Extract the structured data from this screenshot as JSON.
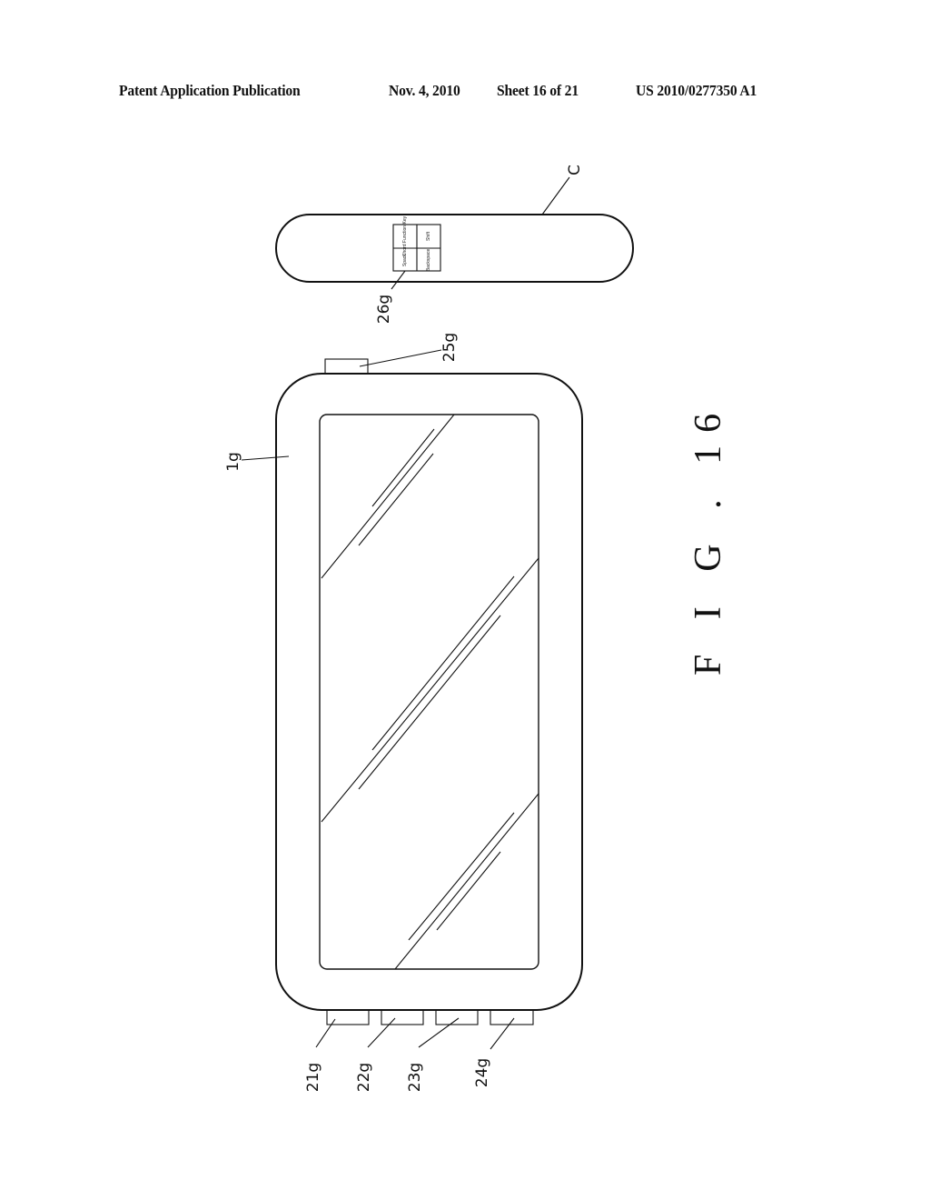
{
  "header": {
    "publication": "Patent Application Publication",
    "date": "Nov. 4, 2010",
    "sheet": "Sheet 16 of 21",
    "patent_number": "US 2010/0277350 A1"
  },
  "figure": {
    "caption": "F I G . 16",
    "controller": {
      "label": "C",
      "keypad_label": "26g",
      "keys": [
        "Chord Function Key",
        "Shift",
        "Space",
        "Backspace"
      ]
    },
    "device": {
      "body_label": "1g",
      "top_button_label": "25g",
      "bottom_button_labels": [
        "21g",
        "22g",
        "23g",
        "24g"
      ]
    }
  }
}
